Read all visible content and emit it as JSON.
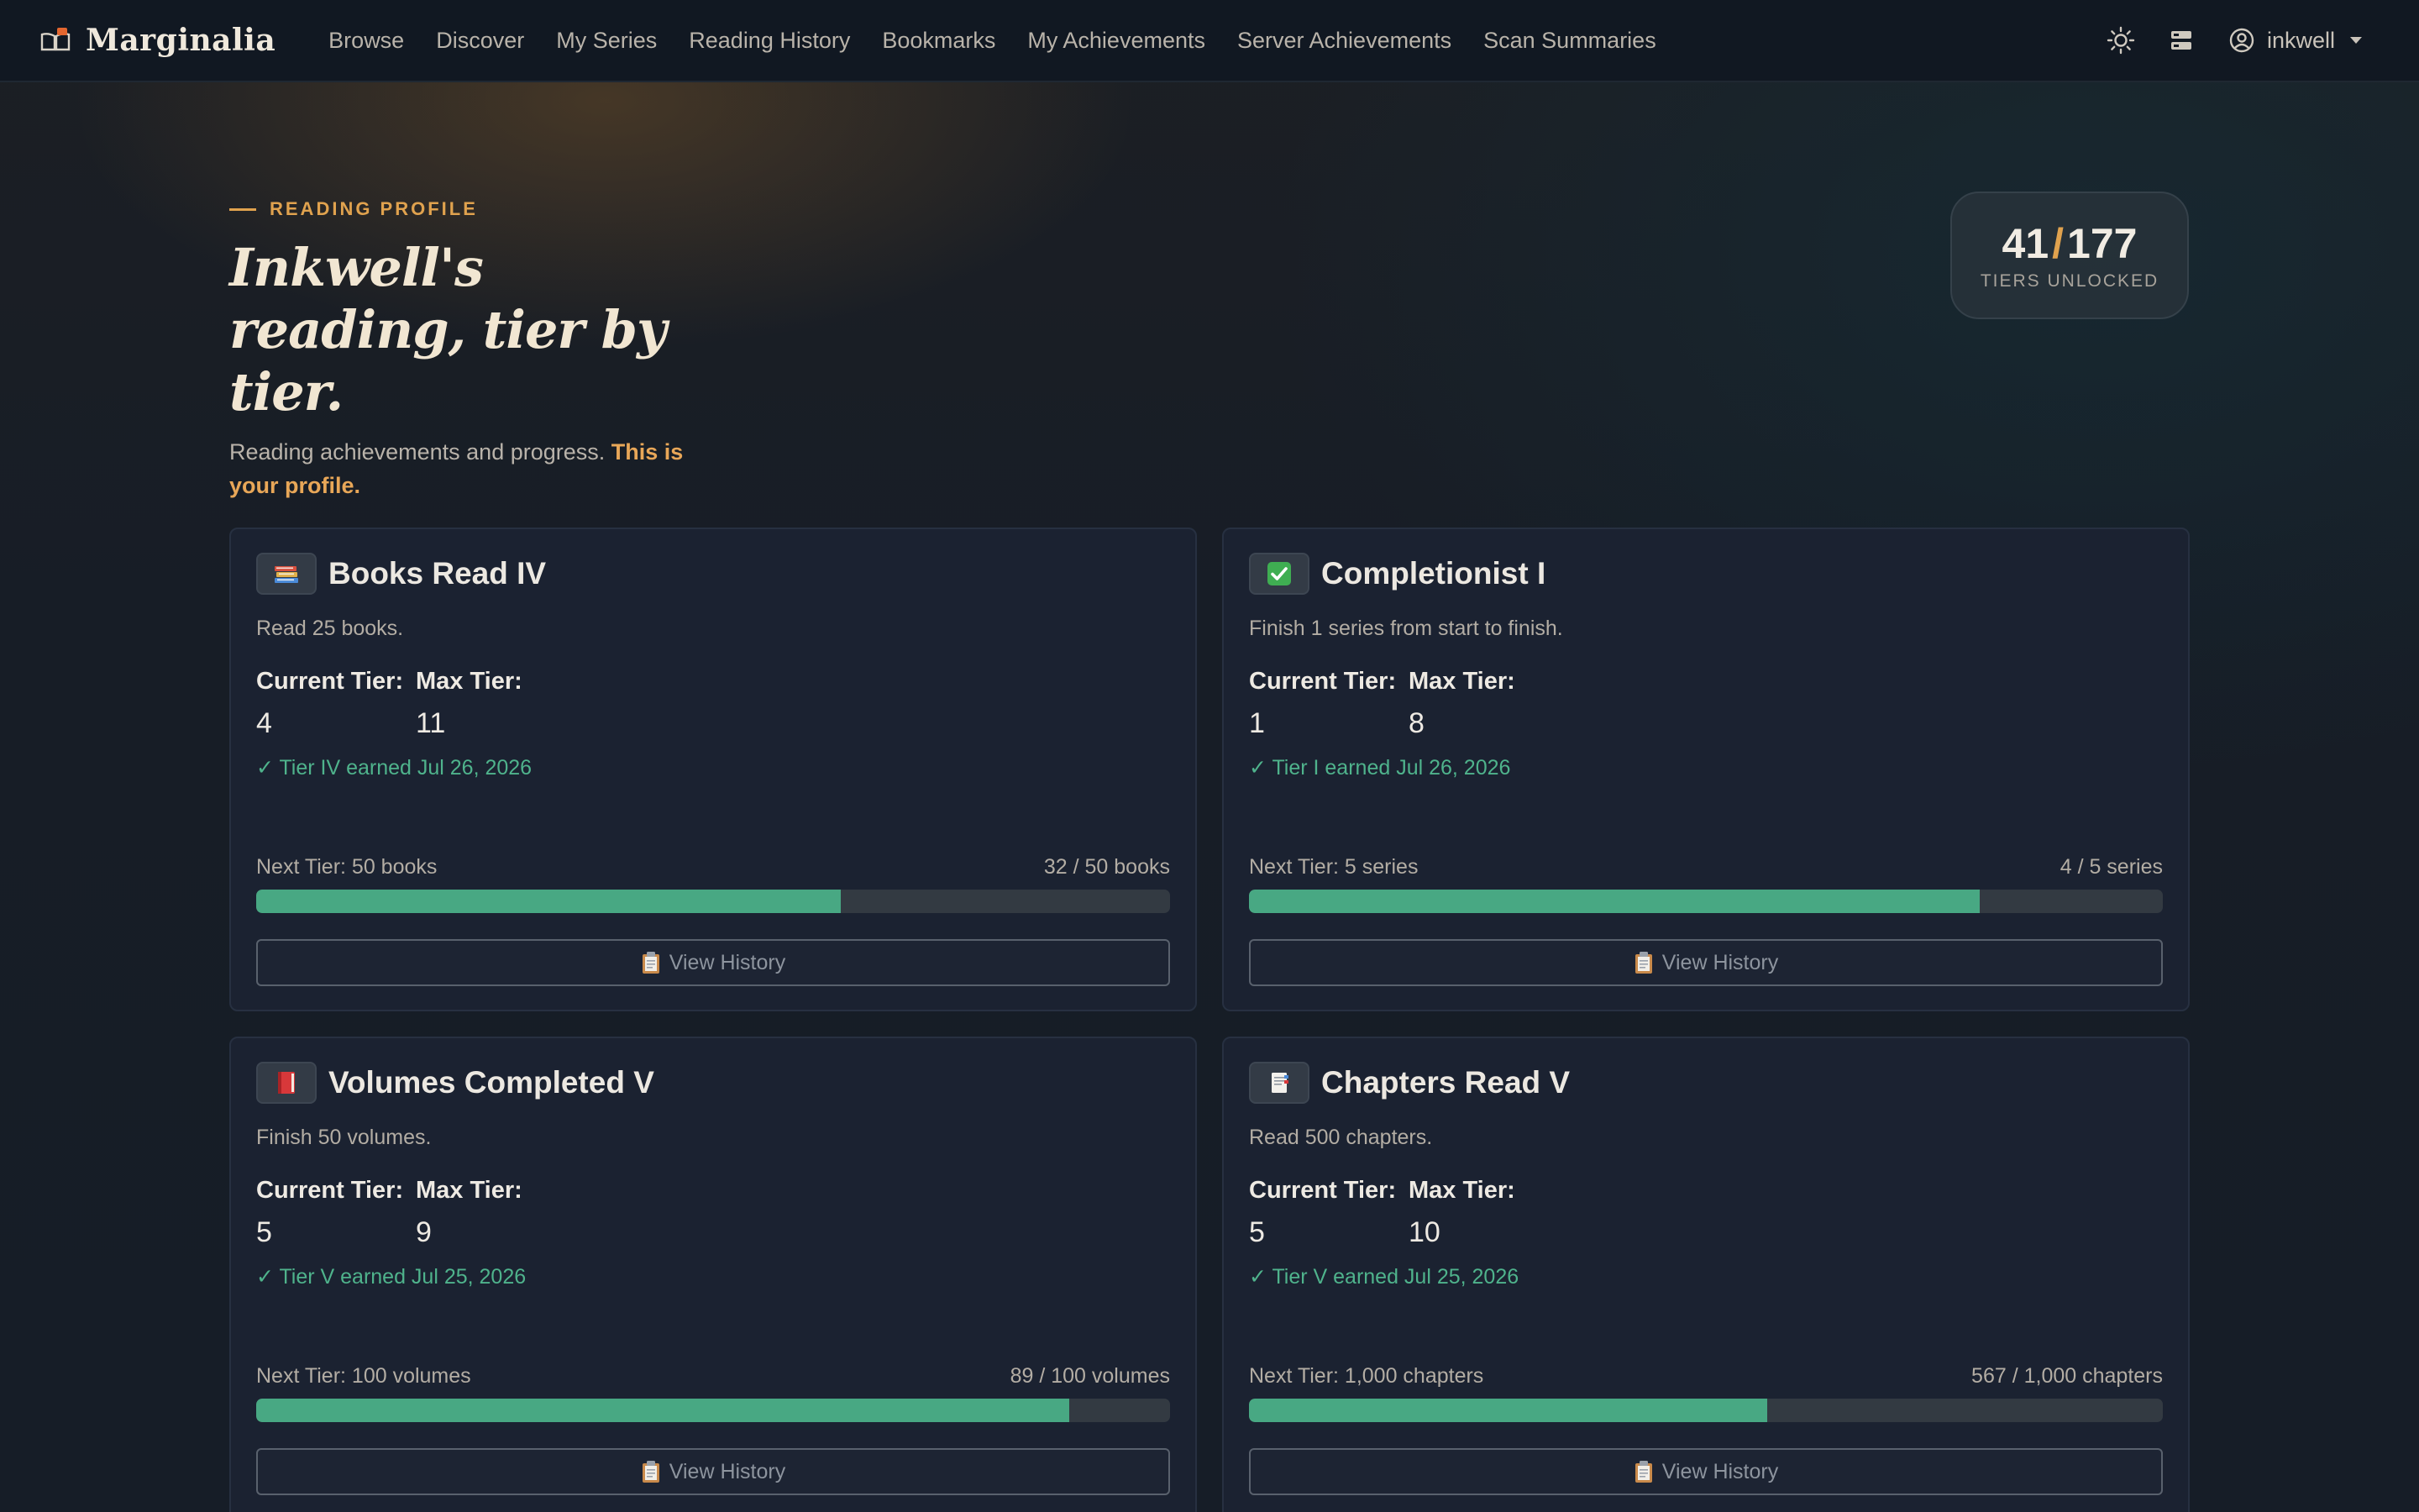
{
  "nav": {
    "brand": "Marginalia",
    "links": [
      "Browse",
      "Discover",
      "My Series",
      "Reading History",
      "Bookmarks",
      "My Achievements",
      "Server Achievements",
      "Scan Summaries"
    ],
    "username": "inkwell"
  },
  "hero": {
    "eyebrow": "READING PROFILE",
    "title": "Inkwell's reading, tier by tier.",
    "subtitle": "Reading achievements and progress.",
    "subtitle_highlight": "This is your profile."
  },
  "tiers": {
    "unlocked": "41",
    "total": "177",
    "label": "TIERS UNLOCKED"
  },
  "labels": {
    "current_tier": "Current Tier:",
    "max_tier": "Max Tier:",
    "view_history": "View History"
  },
  "colors": {
    "accent": "#e0a24e",
    "progress": "#48a883",
    "earned": "#4fb38c"
  },
  "achievements": [
    {
      "icon": "books-icon",
      "title": "Books Read IV",
      "description": "Read 25 books.",
      "current_tier": "4",
      "max_tier": "11",
      "earned": "✓ Tier IV earned Jul 26, 2026",
      "next_tier": "Next Tier: 50 books",
      "progress_text": "32 / 50 books",
      "progress": 0.64
    },
    {
      "icon": "check-mark-icon",
      "title": "Completionist I",
      "description": "Finish 1 series from start to finish.",
      "current_tier": "1",
      "max_tier": "8",
      "earned": "✓ Tier I earned Jul 26, 2026",
      "next_tier": "Next Tier: 5 series",
      "progress_text": "4 / 5 series",
      "progress": 0.8
    },
    {
      "icon": "red-book-icon",
      "title": "Volumes Completed V",
      "description": "Finish 50 volumes.",
      "current_tier": "5",
      "max_tier": "9",
      "earned": "✓ Tier V earned Jul 25, 2026",
      "next_tier": "Next Tier: 100 volumes",
      "progress_text": "89 / 100 volumes",
      "progress": 0.89
    },
    {
      "icon": "bookmark-tabs-icon",
      "title": "Chapters Read V",
      "description": "Read 500 chapters.",
      "current_tier": "5",
      "max_tier": "10",
      "earned": "✓ Tier V earned Jul 25, 2026",
      "next_tier": "Next Tier: 1,000 chapters",
      "progress_text": "567 / 1,000 chapters",
      "progress": 0.567
    }
  ]
}
